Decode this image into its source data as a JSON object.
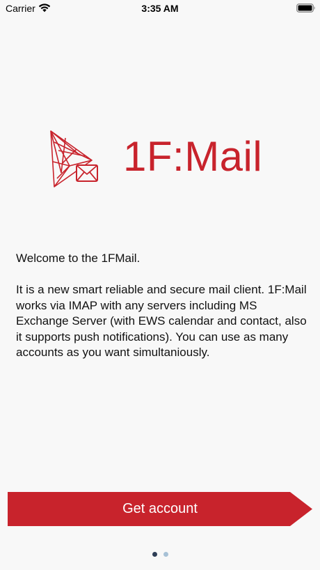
{
  "status_bar": {
    "carrier": "Carrier",
    "time": "3:35 AM",
    "icons": [
      "wifi-icon",
      "battery-icon"
    ]
  },
  "logo": {
    "icon": "mail-paper-plane-logo",
    "text": "1F:Mail",
    "color": "#c8232c"
  },
  "welcome": {
    "heading": "Welcome to the 1FMail.",
    "body": "It is a new smart reliable and secure mail client. 1F:Mail works via IMAP with any servers including MS Exchange Server (with EWS calendar and contact, also it supports push notifications). You can use as many accounts as you want simultaniously."
  },
  "cta": {
    "label": "Get account",
    "color": "#c8232c"
  },
  "pager": {
    "count": 2,
    "current": 1,
    "active_color": "#2e3e56",
    "inactive_color": "#a7c1d6"
  }
}
